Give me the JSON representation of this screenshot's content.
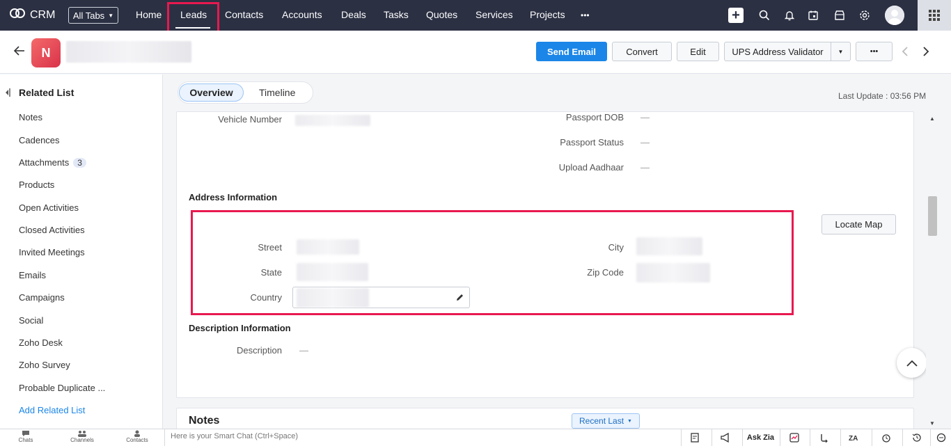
{
  "app": {
    "name": "CRM"
  },
  "nav": {
    "all_tabs": "All Tabs",
    "items": [
      "Home",
      "Leads",
      "Contacts",
      "Accounts",
      "Deals",
      "Tasks",
      "Quotes",
      "Services",
      "Projects"
    ],
    "more": "•••"
  },
  "record": {
    "avatar_letter": "N",
    "buttons": {
      "send_email": "Send Email",
      "convert": "Convert",
      "edit": "Edit",
      "ups": "UPS Address Validator",
      "more": "•••"
    }
  },
  "sidebar": {
    "title": "Related List",
    "items": [
      "Notes",
      "Cadences",
      "Attachments",
      "Products",
      "Open Activities",
      "Closed Activities",
      "Invited Meetings",
      "Emails",
      "Campaigns",
      "Social",
      "Zoho Desk",
      "Zoho Survey",
      "Probable Duplicate ..."
    ],
    "attachments_count": "3",
    "add_related": "Add Related List"
  },
  "tabs": {
    "overview": "Overview",
    "timeline": "Timeline"
  },
  "last_update": "Last Update : 03:56 PM",
  "fields": {
    "vehicle_number": "Vehicle Number",
    "passport_dob": "Passport DOB",
    "passport_status": "Passport Status",
    "upload_aadhaar": "Upload Aadhaar",
    "empty": "—"
  },
  "address": {
    "heading": "Address Information",
    "street": "Street",
    "city": "City",
    "state": "State",
    "zip": "Zip Code",
    "country": "Country",
    "locate_map": "Locate Map"
  },
  "description": {
    "heading": "Description Information",
    "label": "Description",
    "value": "—"
  },
  "notes": {
    "title": "Notes",
    "sort": "Recent Last"
  },
  "bottom": {
    "chats": "Chats",
    "channels": "Channels",
    "contacts": "Contacts",
    "smart_chat_placeholder": "Here is your Smart Chat (Ctrl+Space)",
    "ask_zia": "Ask Zia"
  }
}
